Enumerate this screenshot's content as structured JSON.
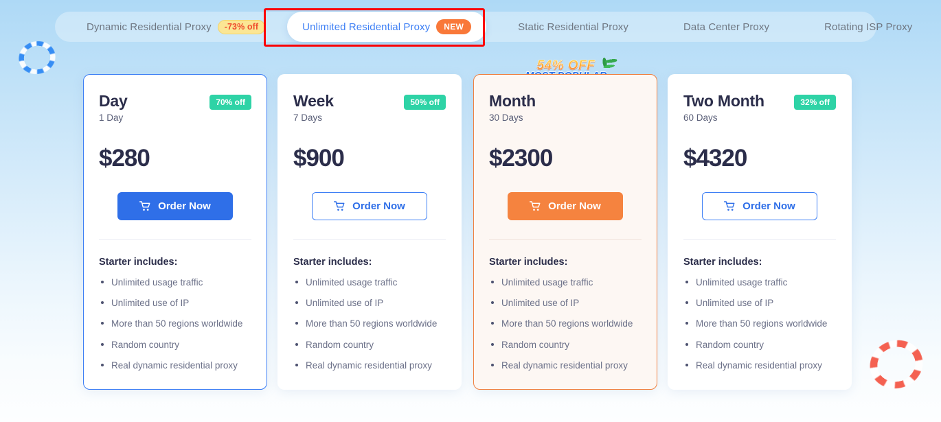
{
  "theme": {
    "accent_blue": "#2f6fe8",
    "accent_orange": "#f5833f",
    "badge_green": "#2ed3a6",
    "badge_yellow": "#fbe694",
    "badge_new_orange": "#f97839",
    "text_dark": "#2b2d4a",
    "annotation_red": "#fb0104"
  },
  "tabs": [
    {
      "label": "Dynamic Residential Proxy",
      "badge": "-73% off",
      "badge_type": "discount",
      "active": false
    },
    {
      "label": "Unlimited Residential Proxy",
      "badge": "NEW",
      "badge_type": "new",
      "active": true
    },
    {
      "label": "Static Residential Proxy",
      "badge": "",
      "badge_type": "",
      "active": false
    },
    {
      "label": "Data Center Proxy",
      "badge": "",
      "badge_type": "",
      "active": false
    },
    {
      "label": "Rotating ISP Proxy",
      "badge": "",
      "badge_type": "",
      "active": false
    }
  ],
  "popular": {
    "offer": "54% OFF",
    "label": "MOST POPULAR"
  },
  "plans": [
    {
      "title": "Day",
      "duration": "1 Day",
      "discount": "70% off",
      "price": "$280",
      "cta": "Order Now",
      "includes_title": "Starter includes:",
      "features": [
        "Unlimited usage traffic",
        "Unlimited use of IP",
        "More than 50 regions worldwide",
        "Random country",
        "Real dynamic residential proxy"
      ]
    },
    {
      "title": "Week",
      "duration": "7 Days",
      "discount": "50% off",
      "price": "$900",
      "cta": "Order Now",
      "includes_title": "Starter includes:",
      "features": [
        "Unlimited usage traffic",
        "Unlimited use of IP",
        "More than 50 regions worldwide",
        "Random country",
        "Real dynamic residential proxy"
      ]
    },
    {
      "title": "Month",
      "duration": "30 Days",
      "discount": "",
      "price": "$2300",
      "cta": "Order Now",
      "includes_title": "Starter includes:",
      "features": [
        "Unlimited usage traffic",
        "Unlimited use of IP",
        "More than 50 regions worldwide",
        "Random country",
        "Real dynamic residential proxy"
      ]
    },
    {
      "title": "Two Month",
      "duration": "60 Days",
      "discount": "32% off",
      "price": "$4320",
      "cta": "Order Now",
      "includes_title": "Starter includes:",
      "features": [
        "Unlimited usage traffic",
        "Unlimited use of IP",
        "More than 50 regions worldwide",
        "Random country",
        "Real dynamic residential proxy"
      ]
    }
  ]
}
